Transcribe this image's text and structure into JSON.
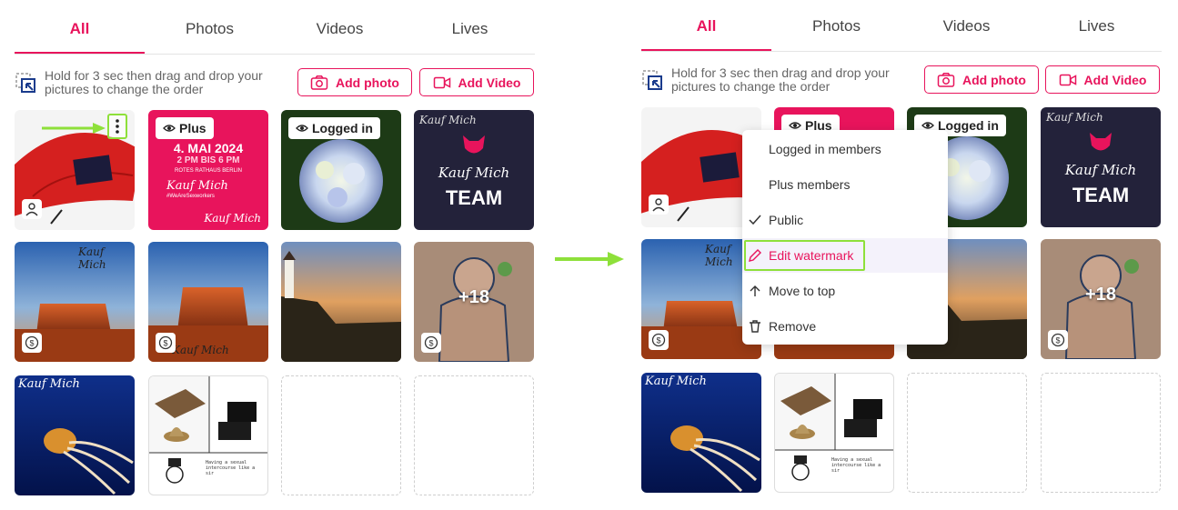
{
  "tabs": [
    {
      "label": "All",
      "active": true
    },
    {
      "label": "Photos",
      "active": false
    },
    {
      "label": "Videos",
      "active": false
    },
    {
      "label": "Lives",
      "active": false
    }
  ],
  "hint": {
    "text": "Hold for 3 sec then drag and drop your pictures to change the order"
  },
  "buttons": {
    "add_photo": "Add photo",
    "add_video": "Add Video"
  },
  "badges": {
    "plus": "Plus",
    "logged_in": "Logged in"
  },
  "counts": {
    "more": "+18"
  },
  "images": {
    "event_poster": {
      "line1": "4. MAI 2024",
      "line2": "2 PM BIS 6 PM",
      "line3": "ROTES RATHAUS BERLIN",
      "line4": "#WeAreSexworkers",
      "brand": "Kauf Mich"
    },
    "team_card": {
      "brand": "Kauf Mich",
      "word": "TEAM"
    },
    "brand_script": "Kauf Mich",
    "comic_caption": "Having a sexual intercourse like a sir"
  },
  "context_menu": {
    "items": [
      {
        "label": "Logged in members",
        "icon": "none"
      },
      {
        "label": "Plus members",
        "icon": "none"
      },
      {
        "label": "Public",
        "icon": "check-icon"
      },
      {
        "label": "Edit watermark",
        "icon": "pencil-icon",
        "highlighted": true
      },
      {
        "label": "Move to top",
        "icon": "arrow-up-icon"
      },
      {
        "label": "Remove",
        "icon": "trash-icon"
      }
    ]
  },
  "colors": {
    "accent": "#e8145c",
    "highlight": "#8ee03a",
    "dark_navy": "#23223a"
  }
}
